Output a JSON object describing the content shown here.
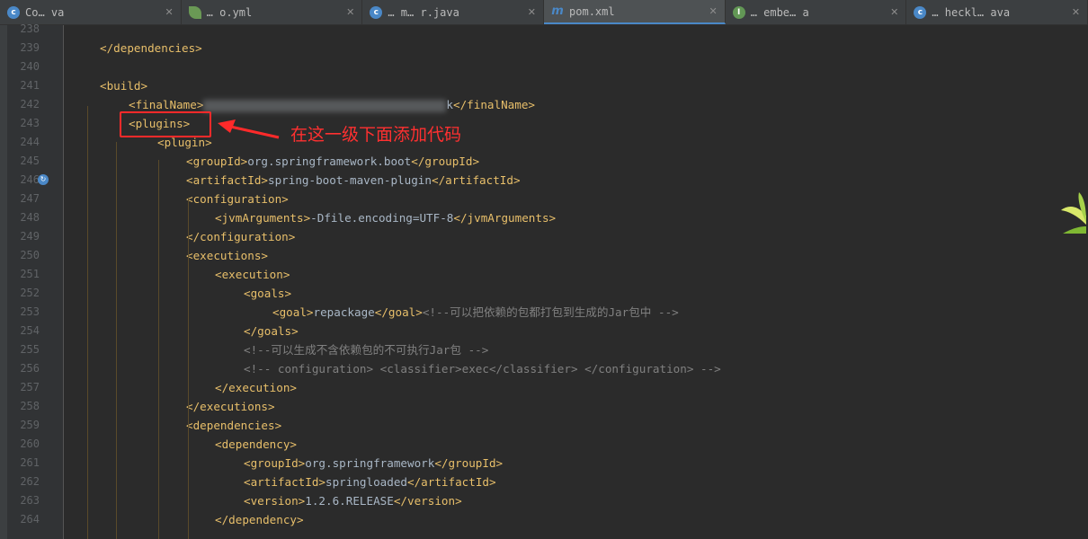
{
  "tabs": [
    {
      "label": "Co…         va",
      "icon": "c",
      "icon_color": "#4a88c7"
    },
    {
      "label": "…             o.yml",
      "icon": "leaf",
      "icon_color": "#6a9955"
    },
    {
      "label": "…    m…          r.java",
      "icon": "c",
      "icon_color": "#4a88c7"
    },
    {
      "label": "pom.xml",
      "icon": "m",
      "icon_color": "#4a88c7",
      "active": true
    },
    {
      "label": "…       embe…        a",
      "icon": "i",
      "icon_color": "#629755"
    },
    {
      "label": "…        heckl…       ava",
      "icon": "c",
      "icon_color": "#4a88c7"
    }
  ],
  "lines": [
    {
      "num": "238",
      "segs": []
    },
    {
      "num": "239",
      "segs": [
        [
          "</",
          "p"
        ],
        [
          "dependencies",
          "p"
        ],
        [
          ">",
          "p"
        ]
      ]
    },
    {
      "num": "240",
      "segs": []
    },
    {
      "num": "241",
      "segs": [
        [
          "<build>",
          "p"
        ]
      ]
    },
    {
      "num": "242",
      "segs": [
        [
          "<finalName>",
          "p"
        ],
        [
          "",
          "blur"
        ],
        [
          "k",
          "t"
        ],
        [
          "</finalName>",
          "p"
        ]
      ]
    },
    {
      "num": "243",
      "segs": [
        [
          "<plugins>",
          "p"
        ]
      ]
    },
    {
      "num": "244",
      "segs": [
        [
          "<plugin>",
          "p"
        ]
      ]
    },
    {
      "num": "245",
      "segs": [
        [
          "<groupId>",
          "p"
        ],
        [
          "org.springframework.boot",
          "t"
        ],
        [
          "</groupId>",
          "p"
        ]
      ]
    },
    {
      "num": "246",
      "segs": [
        [
          "<artifactId>",
          "p"
        ],
        [
          "spring-boot-maven-plugin",
          "t"
        ],
        [
          "</artifactId>",
          "p"
        ]
      ]
    },
    {
      "num": "247",
      "segs": [
        [
          "<configuration>",
          "p"
        ]
      ]
    },
    {
      "num": "248",
      "segs": [
        [
          "<jvmArguments>",
          "p"
        ],
        [
          "-Dfile.encoding=UTF-8",
          "t"
        ],
        [
          "</jvmArguments>",
          "p"
        ]
      ]
    },
    {
      "num": "249",
      "segs": [
        [
          "</configuration>",
          "p"
        ]
      ]
    },
    {
      "num": "250",
      "segs": [
        [
          "<executions>",
          "p"
        ]
      ]
    },
    {
      "num": "251",
      "segs": [
        [
          "<execution>",
          "p"
        ]
      ]
    },
    {
      "num": "252",
      "segs": [
        [
          "<goals>",
          "p"
        ]
      ]
    },
    {
      "num": "253",
      "segs": [
        [
          "<goal>",
          "p"
        ],
        [
          "repackage",
          "t"
        ],
        [
          "</goal>",
          "p"
        ],
        [
          "<!--可以把依赖的包都打包到生成的Jar包中 -->",
          "c"
        ]
      ]
    },
    {
      "num": "254",
      "segs": [
        [
          "</goals>",
          "p"
        ]
      ]
    },
    {
      "num": "255",
      "segs": [
        [
          "<!--可以生成不含依赖包的不可执行Jar包 -->",
          "c"
        ]
      ]
    },
    {
      "num": "256",
      "segs": [
        [
          "<!-- configuration> <classifier>exec</classifier> </configuration> -->",
          "c"
        ]
      ]
    },
    {
      "num": "257",
      "segs": [
        [
          "</execution>",
          "p"
        ]
      ]
    },
    {
      "num": "258",
      "segs": [
        [
          "</executions>",
          "p"
        ]
      ]
    },
    {
      "num": "259",
      "segs": [
        [
          "<dependencies>",
          "p"
        ]
      ]
    },
    {
      "num": "260",
      "segs": [
        [
          "<dependency>",
          "p"
        ]
      ]
    },
    {
      "num": "261",
      "segs": [
        [
          "<groupId>",
          "p"
        ],
        [
          "org.springframework",
          "t"
        ],
        [
          "</groupId>",
          "p"
        ]
      ]
    },
    {
      "num": "262",
      "segs": [
        [
          "<artifactId>",
          "p"
        ],
        [
          "springloaded",
          "t"
        ],
        [
          "</artifactId>",
          "p"
        ]
      ]
    },
    {
      "num": "263",
      "segs": [
        [
          "<version>",
          "p"
        ],
        [
          "1.2.6.RELEASE",
          "t"
        ],
        [
          "</version>",
          "p"
        ]
      ]
    },
    {
      "num": "264",
      "segs": [
        [
          "</dependency>",
          "p"
        ]
      ]
    }
  ],
  "annotation": {
    "text": "在这一级下面添加代码",
    "color": "#ff3030"
  },
  "colors": {
    "tag": "#e8bf6a",
    "text": "#a9b7c6",
    "comment": "#808080",
    "bg": "#2b2b2b"
  }
}
